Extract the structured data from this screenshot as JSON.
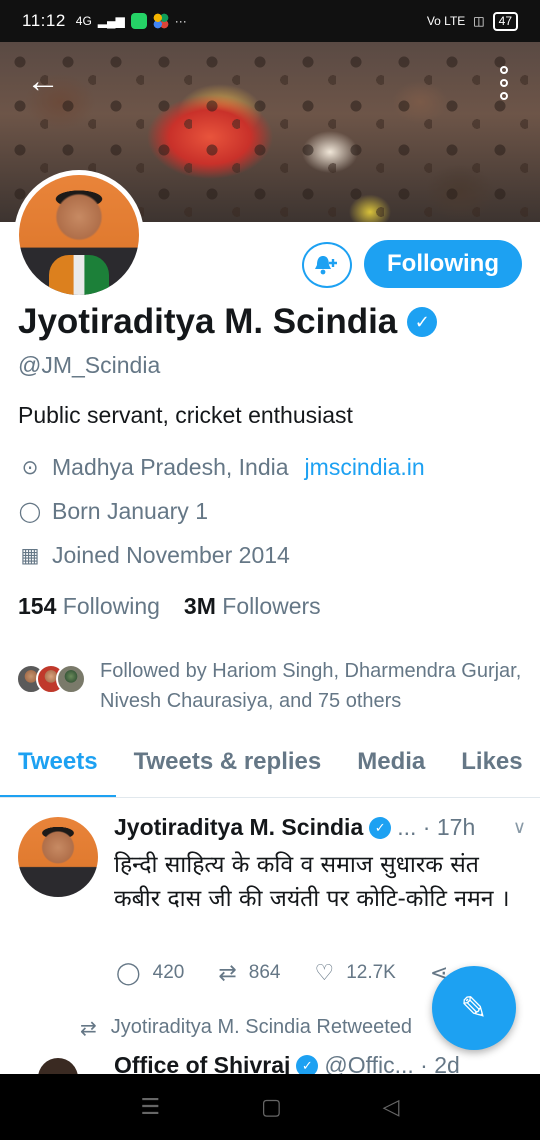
{
  "status": {
    "time": "11:12",
    "signal": "4G",
    "battery": "47",
    "volte": "Vo LTE"
  },
  "profile": {
    "name": "Jyotiraditya M. Scindia",
    "handle": "@JM_Scindia",
    "bio": "Public servant, cricket enthusiast",
    "location": "Madhya Pradesh, India",
    "website": "jmscindia.in",
    "born": "Born January 1",
    "joined": "Joined November 2014",
    "following_count": "154",
    "following_label": "Following",
    "followers_count": "3M",
    "followers_label": "Followers",
    "followed_by": "Followed by Hariom Singh, Dharmendra Gurjar, Nivesh Chaurasiya, and 75 others",
    "follow_button": "Following"
  },
  "tabs": [
    {
      "label": "Tweets",
      "active": true
    },
    {
      "label": "Tweets & replies",
      "active": false
    },
    {
      "label": "Media",
      "active": false
    },
    {
      "label": "Likes",
      "active": false
    }
  ],
  "tweet": {
    "name": "Jyotiraditya M. Scindia",
    "handle": "...",
    "time": "17h",
    "text": "हिन्दी साहित्य के कवि व समाज सुधारक संत कबीर दास जी की जयंती पर कोटि-कोटि नमन ।",
    "replies": "420",
    "retweets": "864",
    "likes": "12.7K"
  },
  "retweet_note": "Jyotiraditya M. Scindia Retweeted",
  "tweet2": {
    "name": "Office of Shivraj",
    "handle": "@Offic...",
    "time": "2d"
  },
  "icons": {
    "back": "back-arrow-icon",
    "more": "more-vertical-icon",
    "notify": "bell-plus-icon",
    "compose": "compose-feather-icon"
  },
  "colors": {
    "accent": "#1da1f2",
    "text": "#14171a",
    "muted": "#657786"
  }
}
